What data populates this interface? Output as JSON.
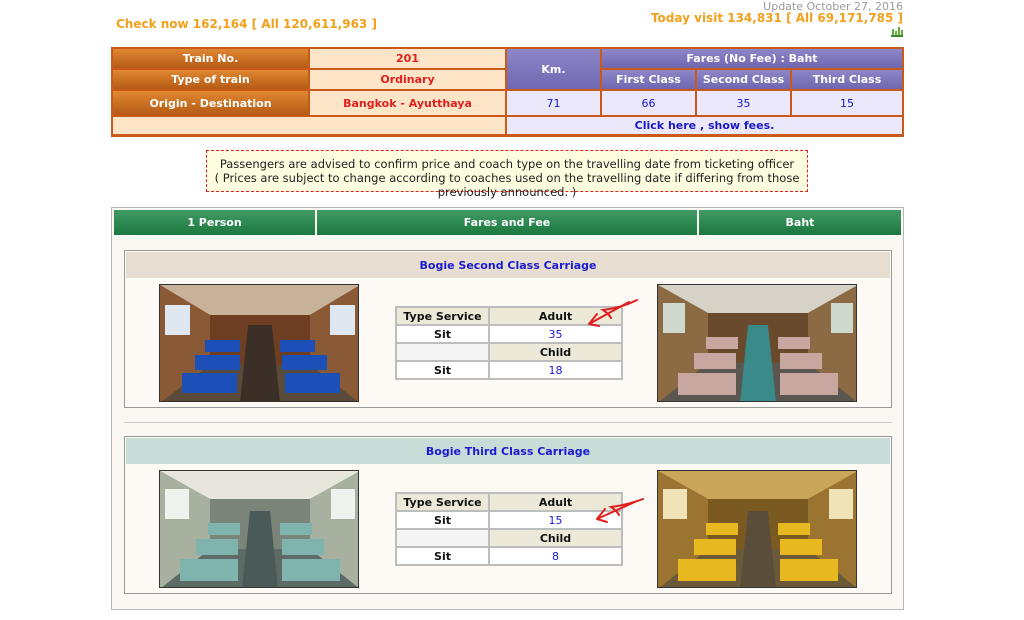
{
  "header": {
    "check_now": "Check now 162,164 [ All 120,611,963 ]",
    "update": "Update October 27, 2016",
    "today_visit": "Today visit 134,831 [ All 69,171,785 ]"
  },
  "train_info": {
    "train_no_label": "Train No.",
    "train_no": "201",
    "type_label": "Type of train",
    "type": "Ordinary",
    "origin_label": "Origin - Destination",
    "origin_destination": "Bangkok - Ayutthaya",
    "km_label": "Km.",
    "km": "71",
    "fares_header": "Fares (No Fee) : Baht",
    "first_class_label": "First Class",
    "second_class_label": "Second Class",
    "third_class_label": "Third Class",
    "first_class_fare": "66",
    "second_class_fare": "35",
    "third_class_fare": "15",
    "show_fees_link": "Click here , show fees."
  },
  "notice": {
    "line1": "Passengers are advised to confirm price and coach type on the travelling date from ticketing officer",
    "line2": "( Prices are subject to change according to coaches used on the travelling date if differing from those previously announced. )"
  },
  "fees_table": {
    "col_person": "1 Person",
    "col_fares": "Fares and Fee",
    "col_baht": "Baht"
  },
  "carriages": [
    {
      "title": "Bogie Second Class Carriage",
      "type_service_label": "Type Service",
      "adult_label": "Adult",
      "child_label": "Child",
      "sit_label": "Sit",
      "adult_fare": "35",
      "child_fare": "18"
    },
    {
      "title": "Bogie Third Class Carriage",
      "type_service_label": "Type Service",
      "adult_label": "Adult",
      "child_label": "Child",
      "sit_label": "Sit",
      "adult_fare": "15",
      "child_fare": "8"
    }
  ],
  "colors": {
    "orange_accent": "#f2a01c",
    "orange_header": "#c95a1a",
    "purple_header": "#7770b9",
    "green_header": "#2a8650",
    "link_blue": "#1a1ad0",
    "annotation_red": "#e02020"
  },
  "icons": {
    "stats": "bar-chart-icon",
    "annotation": "red-arrow-icon"
  }
}
